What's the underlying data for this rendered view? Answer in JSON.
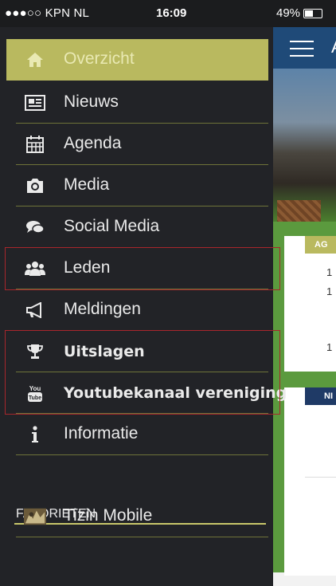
{
  "status": {
    "carrier": "●●●○○ KPN NL",
    "time": "16:09",
    "battery": "49%"
  },
  "menu": {
    "items": [
      {
        "label": "Overzicht"
      },
      {
        "label": "Nieuws"
      },
      {
        "label": "Agenda"
      },
      {
        "label": "Media"
      },
      {
        "label": "Social Media"
      },
      {
        "label": "Leden"
      },
      {
        "label": "Meldingen"
      },
      {
        "label": "Uitslagen"
      },
      {
        "label": "Youtubekanaal vereniging"
      },
      {
        "label": "Informatie"
      }
    ],
    "favorites_title": "FAVORIETEN",
    "favorites": [
      {
        "label": "Tizin Mobile"
      }
    ],
    "youtube_badge_top": "You",
    "youtube_badge_bottom": "Tube"
  },
  "background": {
    "header_letter": "A",
    "card1_tab": "AG",
    "card1_rows": [
      "1",
      "1",
      "1"
    ],
    "card2_tab": "NI"
  },
  "colors": {
    "accent": "#b9b95f",
    "header": "#1f4a78",
    "highlight": "#a8262c"
  }
}
